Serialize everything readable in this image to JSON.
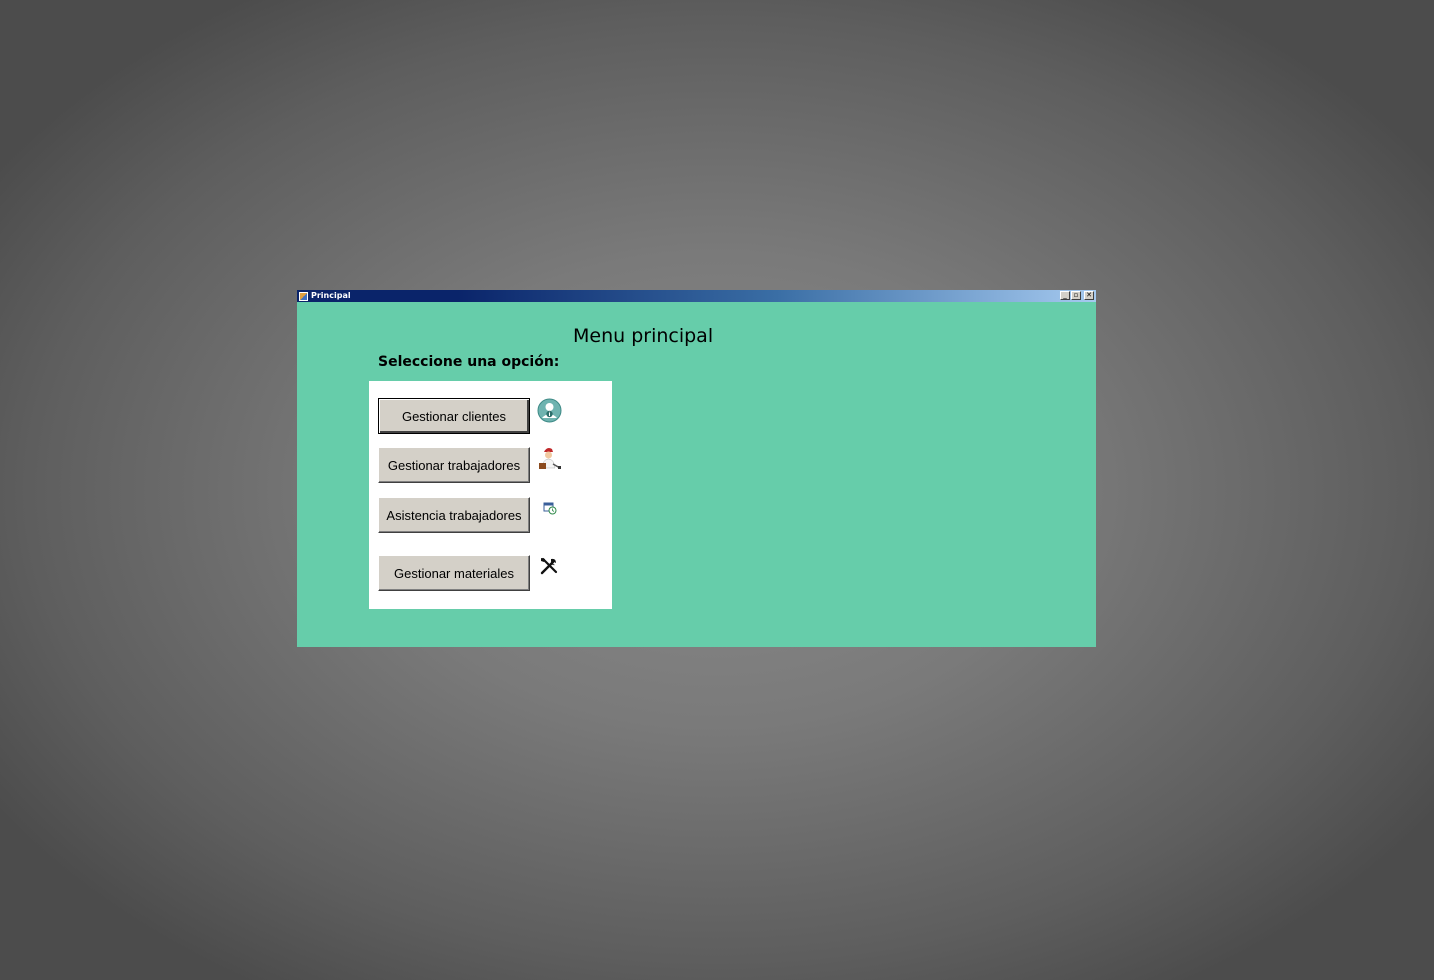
{
  "window": {
    "title": "Principal",
    "controls": {
      "minimize": "_",
      "maximize": "▫",
      "close": "✕"
    }
  },
  "main": {
    "heading": "Menu principal",
    "prompt": "Seleccione una opción:",
    "buttons": [
      {
        "label": "Gestionar clientes",
        "icon": "client-info-icon"
      },
      {
        "label": "Gestionar trabajadores",
        "icon": "worker-icon"
      },
      {
        "label": "Asistencia trabajadores",
        "icon": "calendar-clock-icon"
      },
      {
        "label": "Gestionar materiales",
        "icon": "tools-icon"
      }
    ]
  },
  "colors": {
    "window_background": "#66cdaa",
    "panel_background": "#ffffff",
    "button_face": "#d4d0c8",
    "titlebar_start": "#0a246a",
    "titlebar_end": "#a6caf0"
  }
}
